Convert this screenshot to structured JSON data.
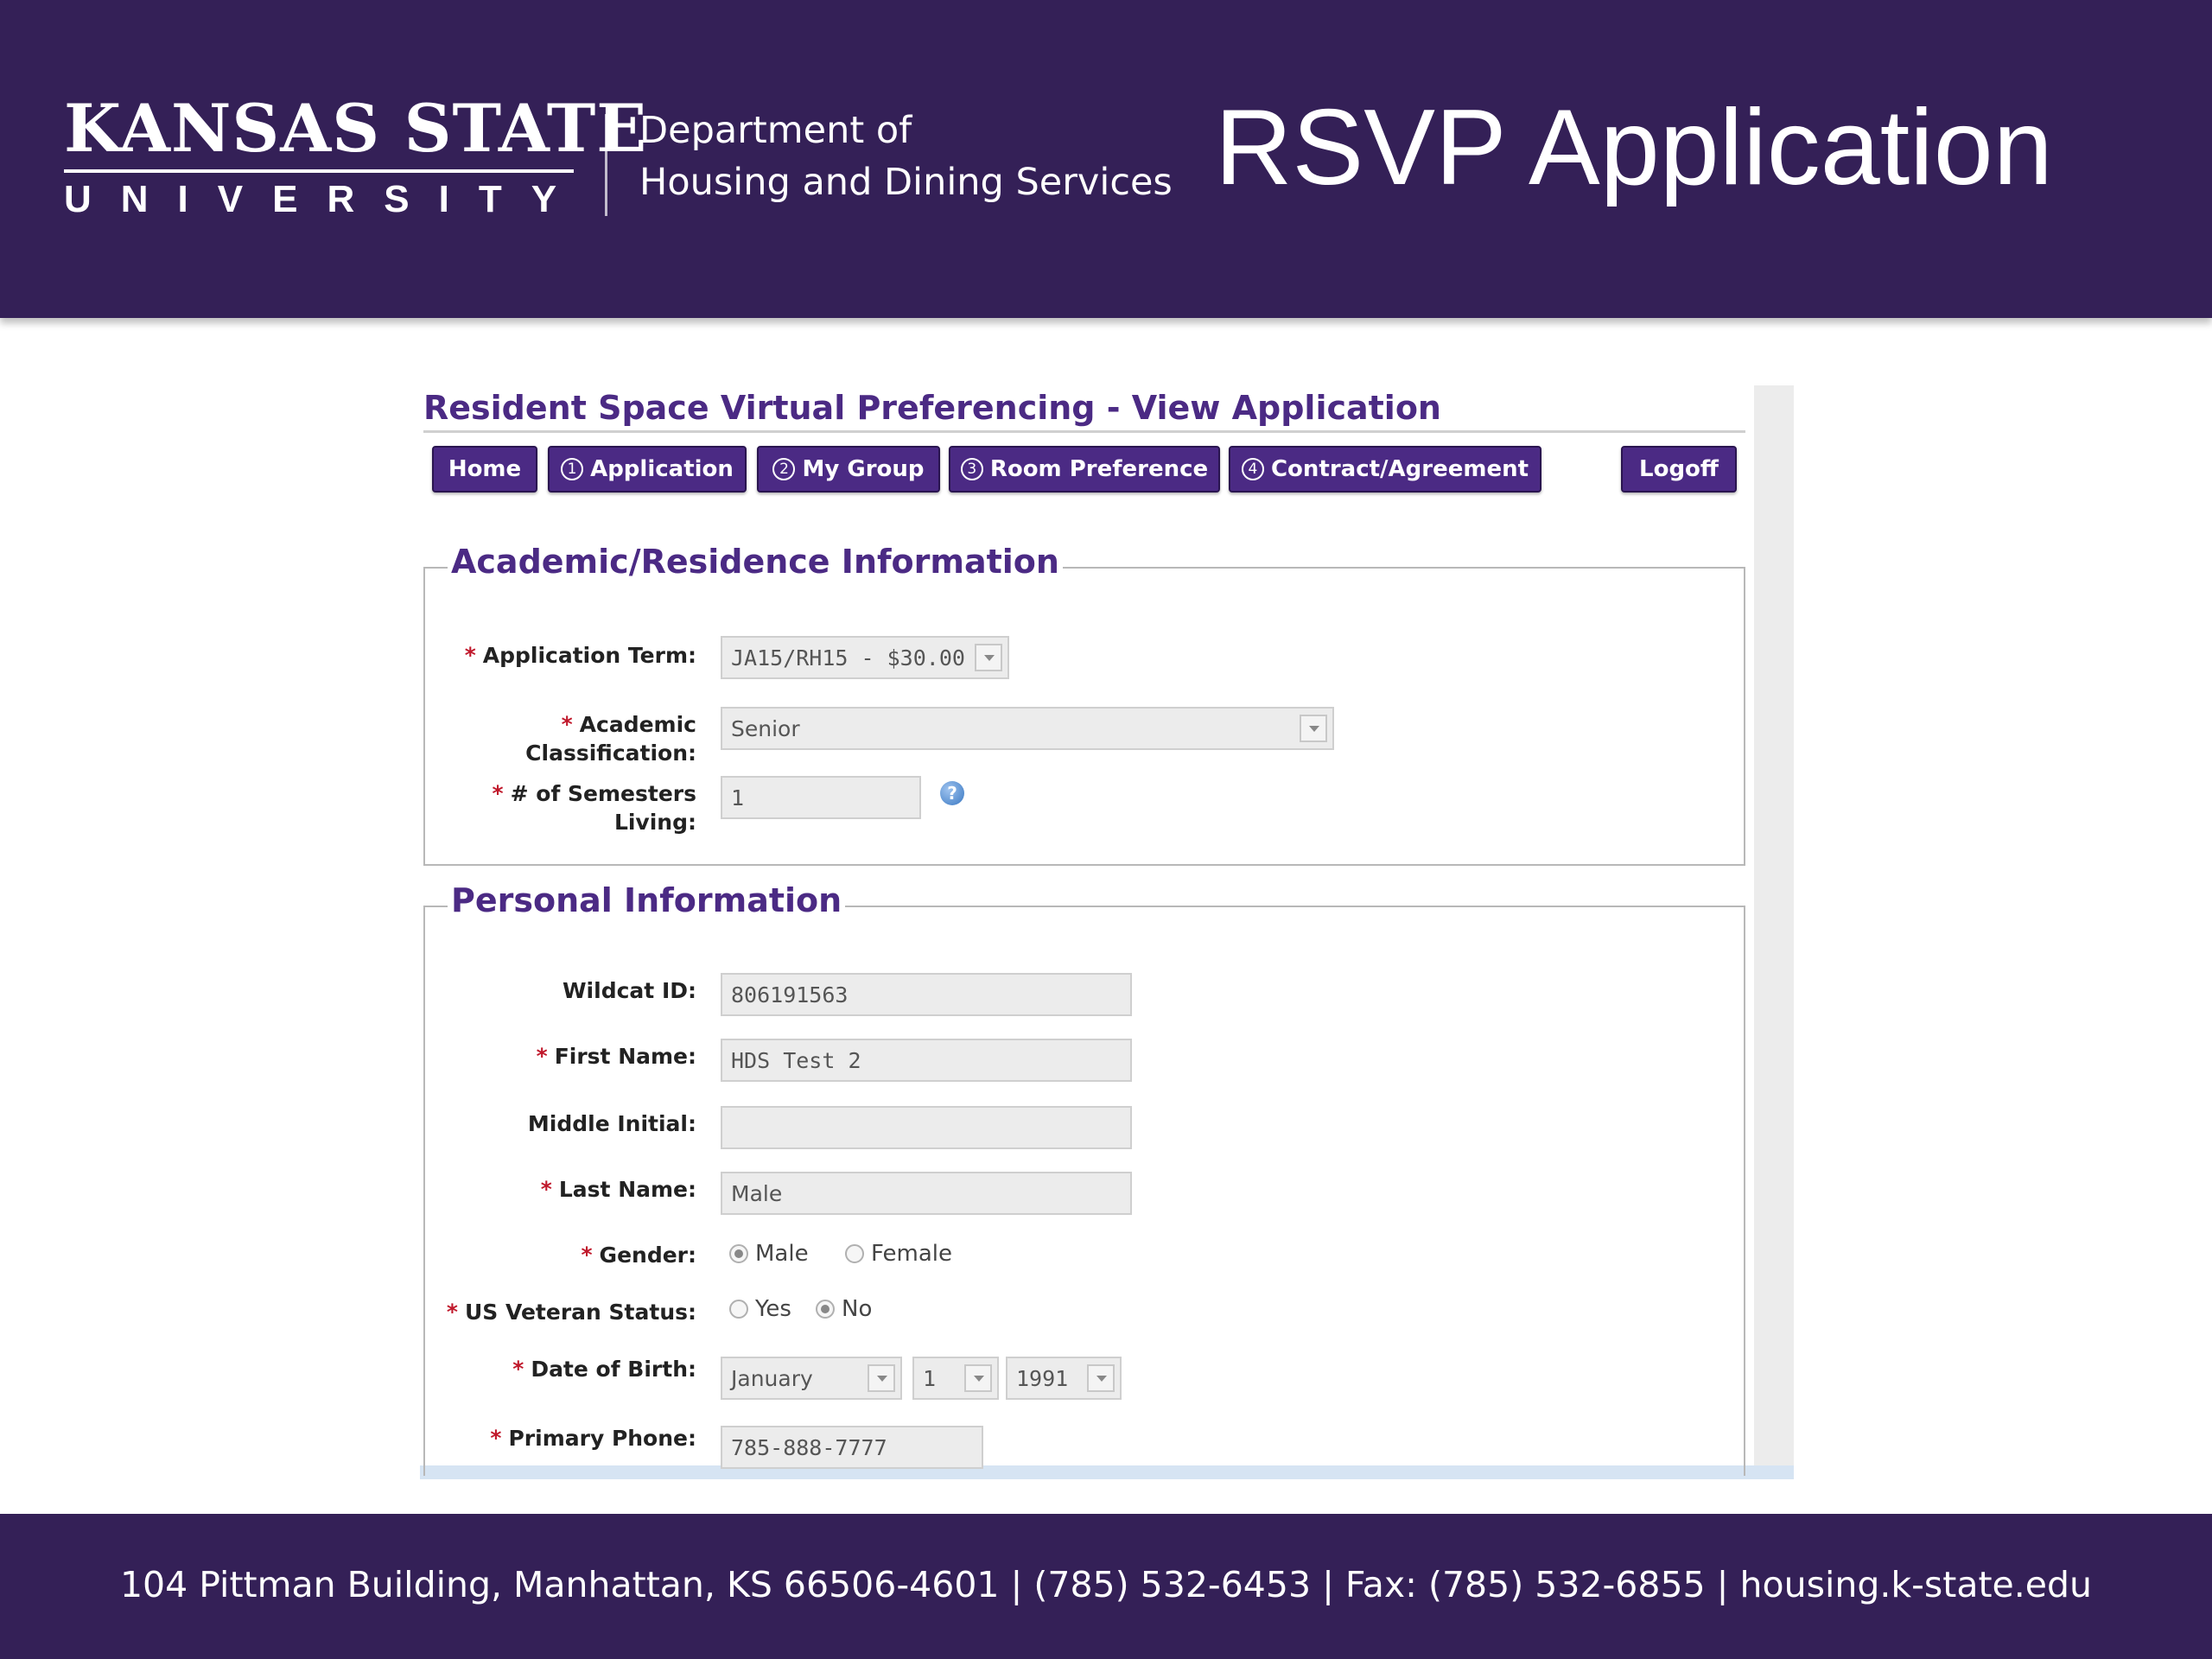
{
  "header": {
    "logo_line1": "KANSAS STATE",
    "logo_line2": "UNIVERSITY",
    "dept_line1": "Department of",
    "dept_line2": "Housing and Dining Services",
    "slide_title": "RSVP Application"
  },
  "app": {
    "title": "Resident Space Virtual Preferencing - View Application",
    "nav": [
      {
        "label": "Home",
        "num": ""
      },
      {
        "label": "Application",
        "num": "1"
      },
      {
        "label": "My Group",
        "num": "2"
      },
      {
        "label": "Room Preference",
        "num": "3"
      },
      {
        "label": "Contract/Agreement",
        "num": "4"
      },
      {
        "label": "Logoff",
        "num": ""
      }
    ]
  },
  "academic": {
    "legend": "Academic/Residence Information",
    "term_label": "Application Term:",
    "term_value": "JA15/RH15 - $30.00",
    "class_label_1": "Academic",
    "class_label_2": "Classification:",
    "class_value": "Senior",
    "semesters_label_1": "# of Semesters",
    "semesters_label_2": "Living:",
    "semesters_value": "1",
    "help_icon": "?"
  },
  "personal": {
    "legend": "Personal Information",
    "wildcat_label": "Wildcat ID:",
    "wildcat_value": "806191563",
    "first_label": "First Name:",
    "first_value": "HDS Test 2",
    "middle_label": "Middle Initial:",
    "middle_value": "",
    "last_label": "Last Name:",
    "last_value": "Male",
    "gender_label": "Gender:",
    "gender_options": [
      "Male",
      "Female"
    ],
    "gender_selected": "Male",
    "veteran_label": "US Veteran Status:",
    "veteran_options": [
      "Yes",
      "No"
    ],
    "veteran_selected": "No",
    "dob_label": "Date of Birth:",
    "dob_month": "January",
    "dob_day": "1",
    "dob_year": "1991",
    "phone_label": "Primary Phone:",
    "phone_value": "785-888-7777"
  },
  "required_marker": "*",
  "footer": {
    "text": "104 Pittman Building, Manhattan, KS 66506-4601  |  (785) 532-6453  |  Fax: (785) 532-6855  |  housing.k-state.edu"
  },
  "colors": {
    "brand_purple": "#342057",
    "button_purple": "#4b2a84",
    "required_red": "#c0182b"
  }
}
